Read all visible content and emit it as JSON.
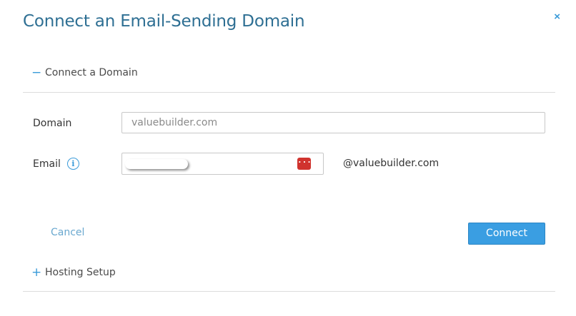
{
  "dialog": {
    "title": "Connect an Email-Sending Domain",
    "close_glyph": "×"
  },
  "sections": {
    "connect_domain": {
      "label": "Connect a Domain",
      "toggle_glyph": "−",
      "expanded": true
    },
    "hosting_setup": {
      "label": "Hosting Setup",
      "toggle_glyph": "+",
      "expanded": false
    }
  },
  "form": {
    "domain": {
      "label": "Domain",
      "value": "",
      "placeholder": "valuebuilder.com"
    },
    "email": {
      "label": "Email",
      "info_glyph": "i",
      "value": "",
      "suffix": "@valuebuilder.com",
      "password_manager_glyph": "···"
    }
  },
  "actions": {
    "cancel_label": "Cancel",
    "connect_label": "Connect"
  },
  "colors": {
    "title": "#2e6f93",
    "accent": "#3a9bd9",
    "button": "#3a9ee2",
    "password_manager": "#d0332e"
  },
  "icons": {
    "close": "close-icon",
    "collapse": "minus-icon",
    "expand": "plus-icon",
    "info": "info-icon",
    "password_manager": "password-manager-icon"
  }
}
